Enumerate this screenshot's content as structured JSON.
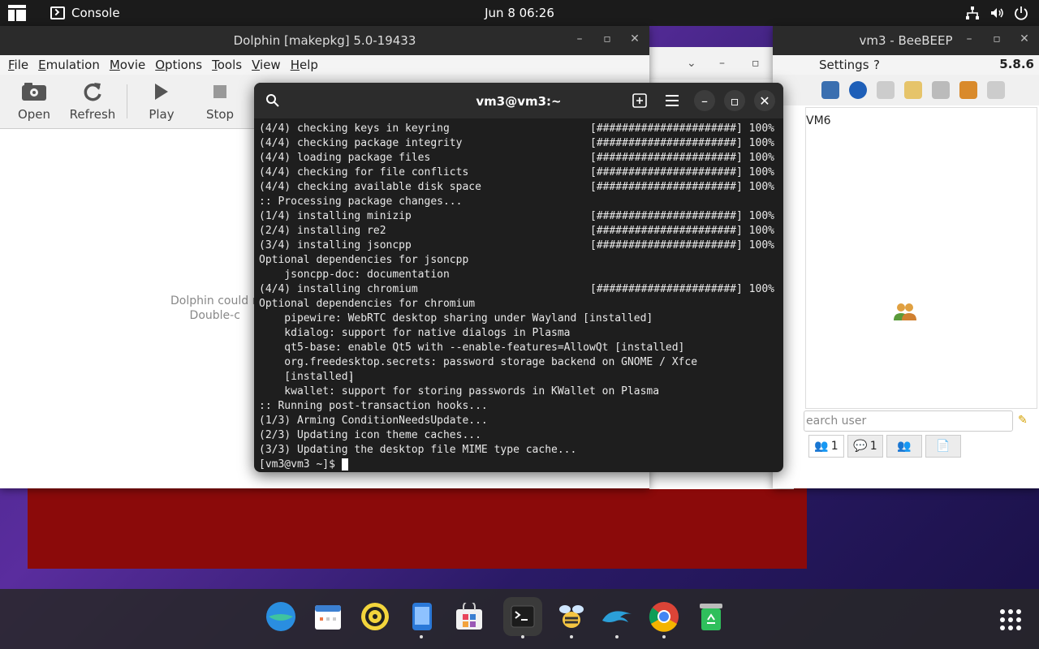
{
  "topbar": {
    "app_name": "Console",
    "clock": "Jun 8  06:26"
  },
  "dolphin": {
    "title": "Dolphin [makepkg] 5.0-19433",
    "menu": [
      "File",
      "Emulation",
      "Movie",
      "Options",
      "Tools",
      "View",
      "Help"
    ],
    "toolbar": [
      "Open",
      "Refresh",
      "Play",
      "Stop"
    ],
    "empty_line1": "Dolphin could n",
    "empty_line2": "Double-c"
  },
  "beebeep": {
    "title": "vm3 - BeeBEEP",
    "menu_settings": "Settings",
    "menu_help": "?",
    "version": "5.8.6",
    "user_row": "VM6",
    "search_placeholder": "earch user",
    "tab_users_count": "1",
    "tab_chat_count": "1"
  },
  "terminal": {
    "title": "vm3@vm3:~",
    "lines": [
      {
        "l": "(4/4) checking keys in keyring",
        "r": "[######################] 100%"
      },
      {
        "l": "(4/4) checking package integrity",
        "r": "[######################] 100%"
      },
      {
        "l": "(4/4) loading package files",
        "r": "[######################] 100%"
      },
      {
        "l": "(4/4) checking for file conflicts",
        "r": "[######################] 100%"
      },
      {
        "l": "(4/4) checking available disk space",
        "r": "[######################] 100%"
      },
      {
        "l": ":: Processing package changes...",
        "r": ""
      },
      {
        "l": "(1/4) installing minizip",
        "r": "[######################] 100%"
      },
      {
        "l": "(2/4) installing re2",
        "r": "[######################] 100%"
      },
      {
        "l": "(3/4) installing jsoncpp",
        "r": "[######################] 100%"
      },
      {
        "l": "Optional dependencies for jsoncpp",
        "r": ""
      },
      {
        "l": "    jsoncpp-doc: documentation",
        "r": ""
      },
      {
        "l": "(4/4) installing chromium",
        "r": "[######################] 100%"
      },
      {
        "l": "Optional dependencies for chromium",
        "r": ""
      },
      {
        "l": "    pipewire: WebRTC desktop sharing under Wayland [installed]",
        "r": ""
      },
      {
        "l": "    kdialog: support for native dialogs in Plasma",
        "r": ""
      },
      {
        "l": "    qt5-base: enable Qt5 with --enable-features=AllowQt [installed]",
        "r": ""
      },
      {
        "l": "    org.freedesktop.secrets: password storage backend on GNOME / Xfce",
        "r": ""
      },
      {
        "l": "    [installed]",
        "r": ""
      },
      {
        "l": "    kwallet: support for storing passwords in KWallet on Plasma",
        "r": ""
      },
      {
        "l": ":: Running post-transaction hooks...",
        "r": ""
      },
      {
        "l": "(1/3) Arming ConditionNeedsUpdate...",
        "r": ""
      },
      {
        "l": "(2/3) Updating icon theme caches...",
        "r": ""
      },
      {
        "l": "(3/3) Updating the desktop file MIME type cache...",
        "r": ""
      }
    ],
    "prompt": "[vm3@vm3 ~]$ "
  },
  "dock": {
    "items": [
      "browser-icon",
      "calendar-icon",
      "audio-icon",
      "phone-icon",
      "software-icon",
      "terminal-icon",
      "beebeep-icon",
      "dolphin-icon",
      "chrome-icon",
      "recycle-icon"
    ]
  },
  "colors": {
    "terminal_bg": "#1e1e1e",
    "chromium_red": "#8b0a0a"
  }
}
